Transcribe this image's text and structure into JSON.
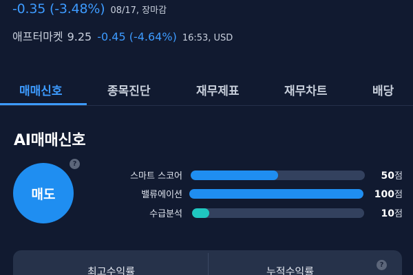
{
  "quote": {
    "change": "-0.35 (-3.48%)",
    "date_status": "08/17, 장마감"
  },
  "after_market": {
    "label": "애프터마켓",
    "price": "9.25",
    "change": "-0.45 (-4.64%)",
    "time_currency": "16:53, USD"
  },
  "tabs": [
    {
      "label": "매매신호",
      "active": true
    },
    {
      "label": "종목진단",
      "active": false
    },
    {
      "label": "재무제표",
      "active": false
    },
    {
      "label": "재무차트",
      "active": false
    },
    {
      "label": "배당",
      "active": false
    }
  ],
  "signal": {
    "title": "AI매매신호",
    "badge": "매도",
    "help": "?",
    "metrics": [
      {
        "label": "스마트 스코어",
        "value": 50,
        "display": "50",
        "unit": "점",
        "percent": 50,
        "color": "#1f8ef1"
      },
      {
        "label": "밸류에이션",
        "value": 100,
        "display": "100",
        "unit": "점",
        "percent": 100,
        "color": "#1f8ef1"
      },
      {
        "label": "수급분석",
        "value": 10,
        "display": "10",
        "unit": "점",
        "percent": 10,
        "color": "#1fc7c0"
      }
    ]
  },
  "returns": {
    "max_label": "최고수익률",
    "cum_label": "누적수익률",
    "help": "?"
  },
  "colors": {
    "accent": "#3d9bff",
    "background": "#111a30",
    "badge": "#1f8ef1"
  }
}
